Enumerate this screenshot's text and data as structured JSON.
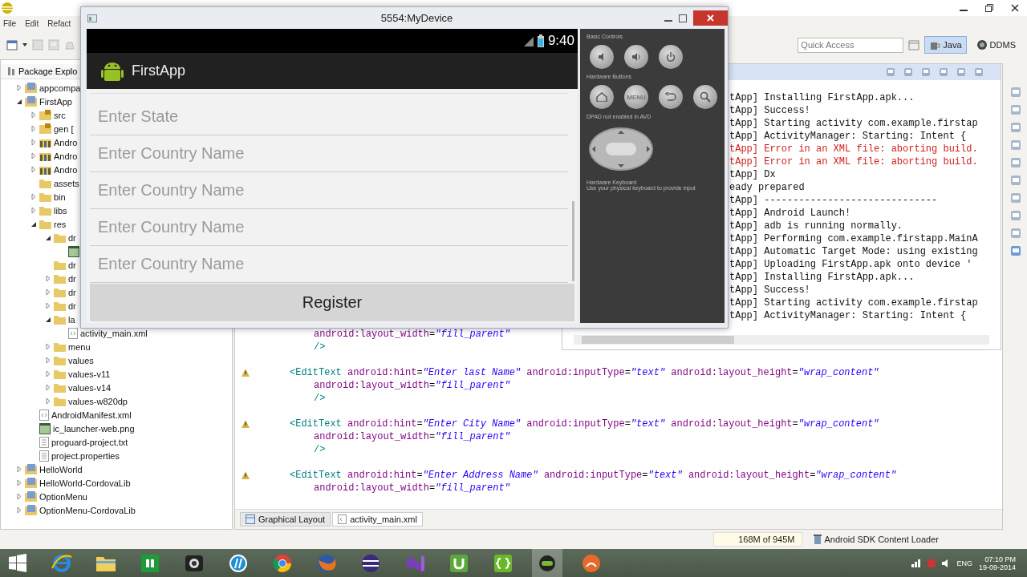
{
  "ide": {
    "menu": [
      "File",
      "Edit",
      "Refact"
    ],
    "quick_access": {
      "placeholder": "Quick Access"
    },
    "perspectives": [
      {
        "label": "Java",
        "selected": true
      },
      {
        "label": "DDMS",
        "selected": false
      }
    ],
    "package_explorer": {
      "title": "Package Explo",
      "tree": [
        {
          "label": "appcompa",
          "kind": "project",
          "expanded": false
        },
        {
          "label": "FirstApp",
          "kind": "project",
          "expanded": true,
          "children": [
            {
              "label": "src",
              "kind": "package",
              "expanded": false
            },
            {
              "label": "gen [",
              "kind": "package",
              "expanded": false
            },
            {
              "label": "Andro",
              "kind": "library",
              "expanded": false
            },
            {
              "label": "Andro",
              "kind": "library",
              "expanded": false
            },
            {
              "label": "Andro",
              "kind": "library",
              "expanded": false
            },
            {
              "label": "assets",
              "kind": "folder"
            },
            {
              "label": "bin",
              "kind": "folder",
              "expanded": false
            },
            {
              "label": "libs",
              "kind": "folder",
              "expanded": false
            },
            {
              "label": "res",
              "kind": "folder",
              "expanded": true,
              "children": [
                {
                  "label": "dr",
                  "kind": "folder",
                  "expanded": true,
                  "children": [
                    {
                      "kind": "image"
                    }
                  ]
                },
                {
                  "label": "dr",
                  "kind": "folder"
                },
                {
                  "label": "dr",
                  "kind": "folder",
                  "expanded": false
                },
                {
                  "label": "dr",
                  "kind": "folder",
                  "expanded": false
                },
                {
                  "label": "dr",
                  "kind": "folder",
                  "expanded": false
                },
                {
                  "label": "la",
                  "kind": "folder",
                  "expanded": true,
                  "children": [
                    {
                      "label": "activity_main.xml",
                      "kind": "xml"
                    }
                  ]
                },
                {
                  "label": "menu",
                  "kind": "folder",
                  "expanded": false
                },
                {
                  "label": "values",
                  "kind": "folder",
                  "expanded": false
                },
                {
                  "label": "values-v11",
                  "kind": "folder",
                  "expanded": false
                },
                {
                  "label": "values-v14",
                  "kind": "folder",
                  "expanded": false
                },
                {
                  "label": "values-w820dp",
                  "kind": "folder",
                  "expanded": false
                }
              ]
            },
            {
              "label": "AndroidManifest.xml",
              "kind": "xml"
            },
            {
              "label": "ic_launcher-web.png",
              "kind": "image"
            },
            {
              "label": "proguard-project.txt",
              "kind": "text"
            },
            {
              "label": "project.properties",
              "kind": "text"
            }
          ]
        },
        {
          "label": "HelloWorld",
          "kind": "project",
          "expanded": false
        },
        {
          "label": "HelloWorld-CordovaLib",
          "kind": "project",
          "expanded": false
        },
        {
          "label": "OptionMenu",
          "kind": "project",
          "expanded": false
        },
        {
          "label": "OptionMenu-CordovaLib",
          "kind": "project",
          "expanded": false
        }
      ]
    },
    "console": {
      "lines": [
        {
          "kind": "info",
          "text": "tApp] Installing FirstApp.apk..."
        },
        {
          "kind": "info",
          "text": "tApp] Success!"
        },
        {
          "kind": "info",
          "text": "tApp] Starting activity com.example.firstap"
        },
        {
          "kind": "info",
          "text": "tApp] ActivityManager: Starting: Intent {"
        },
        {
          "kind": "error",
          "text": "tApp] Error in an XML file: aborting build."
        },
        {
          "kind": "error",
          "text": "tApp] Error in an XML file: aborting build."
        },
        {
          "kind": "info",
          "text": "tApp] Dx"
        },
        {
          "kind": "info",
          "text": "eady prepared"
        },
        {
          "kind": "info",
          "text": "tApp] ------------------------------"
        },
        {
          "kind": "info",
          "text": "tApp] Android Launch!"
        },
        {
          "kind": "info",
          "text": "tApp] adb is running normally."
        },
        {
          "kind": "info",
          "text": "tApp] Performing com.example.firstapp.MainA"
        },
        {
          "kind": "info",
          "text": "tApp] Automatic Target Mode: using existing"
        },
        {
          "kind": "info",
          "text": "tApp] Uploading FirstApp.apk onto device '"
        },
        {
          "kind": "info",
          "text": "tApp] Installing FirstApp.apk..."
        },
        {
          "kind": "info",
          "text": "tApp] Success!"
        },
        {
          "kind": "info",
          "text": "tApp] Starting activity com.example.firstap"
        },
        {
          "kind": "info",
          "text": "tApp] ActivityManager: Starting: Intent {"
        }
      ]
    },
    "editor": {
      "lines": [
        {
          "kind": "attr",
          "warning": false,
          "text": "android:layout_width=\"fill_parent\""
        },
        {
          "kind": "close",
          "warning": false,
          "text": "/>"
        },
        {
          "kind": "blank"
        },
        {
          "kind": "tag",
          "warning": true,
          "text": "<EditText android:hint=\"Enter last Name\" android:inputType=\"text\" android:layout_height=\"wrap_content\""
        },
        {
          "kind": "attr",
          "warning": false,
          "text": "android:layout_width=\"fill_parent\""
        },
        {
          "kind": "close",
          "warning": false,
          "text": "/>"
        },
        {
          "kind": "blank"
        },
        {
          "kind": "tag",
          "warning": true,
          "text": "<EditText android:hint=\"Enter City Name\" android:inputType=\"text\" android:layout_height=\"wrap_content\""
        },
        {
          "kind": "attr",
          "warning": false,
          "text": "android:layout_width=\"fill_parent\""
        },
        {
          "kind": "close",
          "warning": false,
          "text": "/>"
        },
        {
          "kind": "blank"
        },
        {
          "kind": "tag",
          "warning": true,
          "text": "<EditText android:hint=\"Enter Address Name\" android:inputType=\"text\" android:layout_height=\"wrap_content\""
        },
        {
          "kind": "attr",
          "warning": false,
          "text": "android:layout_width=\"fill_parent\""
        }
      ],
      "tabs": [
        {
          "label": "Graphical Layout",
          "selected": false
        },
        {
          "label": "activity_main.xml",
          "selected": true
        }
      ]
    },
    "status_bar": [
      "168M of 945M",
      "Android SDK Content Loader"
    ]
  },
  "emulator": {
    "title": "5554:MyDevice",
    "clock": "9:40",
    "app_title": "FirstApp",
    "fields": [
      {
        "placeholder": "Enter State"
      },
      {
        "placeholder": "Enter Country Name"
      },
      {
        "placeholder": "Enter Country Name"
      },
      {
        "placeholder": "Enter Country Name"
      },
      {
        "placeholder": "Enter Country Name"
      }
    ],
    "button": "Register",
    "controls": {
      "basic_label": "Basic Controls",
      "hardware_label": "Hardware Buttons",
      "menu_key": "MENU",
      "dpad_label": "DPAD not enabled in AVD",
      "keyboard_label": "Hardware Keyboard",
      "keyboard_hint": "Use your physical keyboard to provide input"
    }
  },
  "taskbar": {
    "language": "ENG",
    "time": "07:10 PM",
    "date": "19-09-2014"
  }
}
